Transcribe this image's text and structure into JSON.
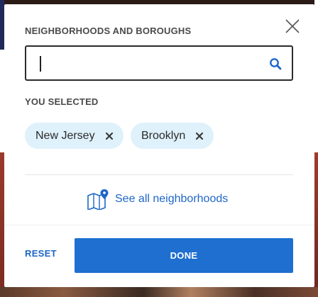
{
  "modal": {
    "title": "NEIGHBORHOODS AND BOROUGHS",
    "close_icon": "close-icon"
  },
  "search": {
    "value": "",
    "placeholder": "",
    "icon": "search-icon"
  },
  "selected": {
    "title": "YOU SELECTED",
    "chips": [
      {
        "label": "New Jersey",
        "remove_icon": "close-icon"
      },
      {
        "label": "Brooklyn",
        "remove_icon": "close-icon"
      }
    ]
  },
  "see_all": {
    "label": "See all neighborhoods",
    "icon": "map-pin-icon"
  },
  "footer": {
    "reset_label": "RESET",
    "done_label": "DONE"
  },
  "colors": {
    "accent": "#1e66c7",
    "button": "#1e6fd0",
    "chip_bg": "#dff1fb",
    "text": "#4a4a4a"
  }
}
